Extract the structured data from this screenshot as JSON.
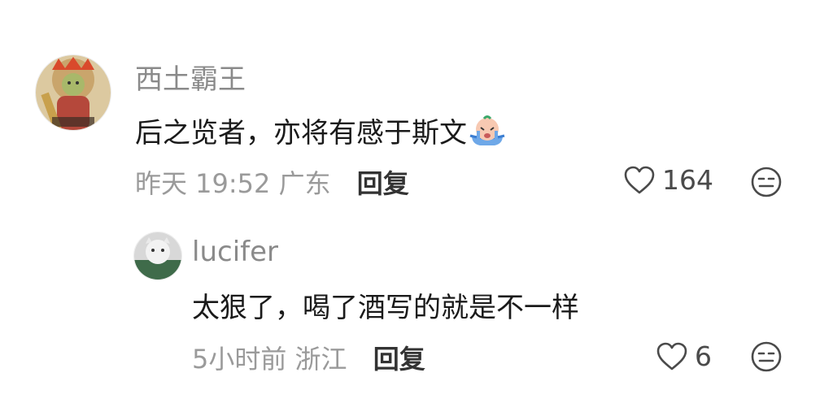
{
  "comments": [
    {
      "username": "西土霸王",
      "text": "后之览者，亦将有感于斯文",
      "emoji": "crying-face-emoji",
      "time": "昨天 19:52",
      "location": "广东",
      "reply_label": "回复",
      "likes": "164"
    },
    {
      "username": "lucifer",
      "text": "太狠了，喝了酒写的就是不一样",
      "time": "5小时前",
      "location": "浙江",
      "reply_label": "回复",
      "likes": "6"
    }
  ],
  "colors": {
    "name": "#8a8a8a",
    "text": "#1a1a1a",
    "meta": "#9a9a9a",
    "reply": "#333333",
    "icon": "#4a4a4a"
  }
}
